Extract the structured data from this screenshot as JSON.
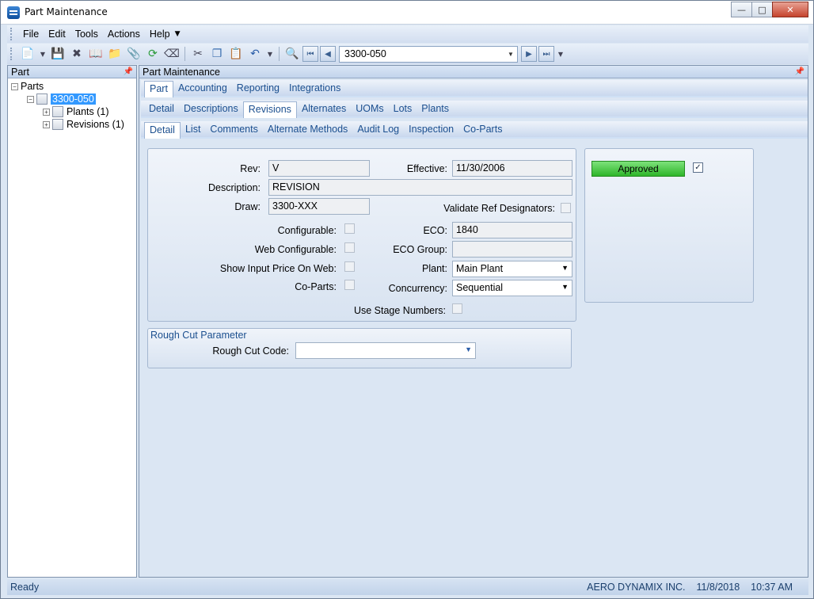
{
  "window": {
    "title": "Part Maintenance"
  },
  "menu": [
    "File",
    "Edit",
    "Tools",
    "Actions",
    "Help"
  ],
  "toolbar": {
    "nav_value": "3300-050"
  },
  "left_panel": {
    "header": "Part",
    "tree": {
      "root": "Parts",
      "selected": "3300-050",
      "children": [
        "Plants (1)",
        "Revisions (1)"
      ]
    }
  },
  "right_panel": {
    "header": "Part Maintenance",
    "tabs_level1": [
      "Part",
      "Accounting",
      "Reporting",
      "Integrations"
    ],
    "tabs_level2": [
      "Detail",
      "Descriptions",
      "Revisions",
      "Alternates",
      "UOMs",
      "Lots",
      "Plants"
    ],
    "tabs_level3": [
      "Detail",
      "List",
      "Comments",
      "Alternate Methods",
      "Audit Log",
      "Inspection",
      "Co-Parts"
    ]
  },
  "form": {
    "rev_label": "Rev:",
    "rev_value": "V",
    "effective_label": "Effective:",
    "effective_value": "11/30/2006",
    "description_label": "Description:",
    "description_value": "REVISION",
    "draw_label": "Draw:",
    "draw_value": "3300-XXX",
    "validate_label": "Validate Ref Designators:",
    "configurable_label": "Configurable:",
    "eco_label": "ECO:",
    "eco_value": "1840",
    "web_configurable_label": "Web Configurable:",
    "eco_group_label": "ECO Group:",
    "eco_group_value": "",
    "show_input_price_label": "Show Input Price On Web:",
    "plant_label": "Plant:",
    "plant_value": "Main Plant",
    "coparts_label": "Co-Parts:",
    "concurrency_label": "Concurrency:",
    "concurrency_value": "Sequential",
    "stage_numbers_label": "Use Stage Numbers:"
  },
  "approval": {
    "status_label": "Approved",
    "checked": true
  },
  "rough_cut": {
    "title": "Rough Cut Parameter",
    "code_label": "Rough Cut Code:",
    "code_value": ""
  },
  "status_bar": {
    "status": "Ready",
    "company": "AERO DYNAMIX INC.",
    "date": "11/8/2018",
    "time": "10:37 AM"
  }
}
